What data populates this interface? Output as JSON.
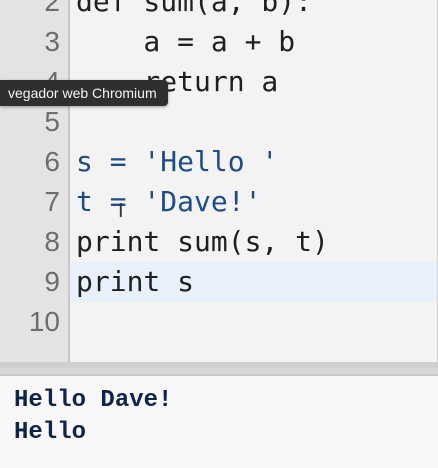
{
  "tooltip": {
    "text": "vegador web Chromium"
  },
  "editor": {
    "line_numbers": [
      "2",
      "3",
      "4",
      "5",
      "6",
      "7",
      "8",
      "9",
      "10"
    ],
    "lines": [
      {
        "number": "2",
        "code": "def sum(a, b):"
      },
      {
        "number": "3",
        "code": "    a = a + b"
      },
      {
        "number": "4",
        "code": "    return a"
      },
      {
        "number": "5",
        "code": ""
      },
      {
        "number": "6",
        "code": "s = 'Hello '"
      },
      {
        "number": "7",
        "code": "t = 'Dave!'"
      },
      {
        "number": "8",
        "code": "print sum(s, t)"
      },
      {
        "number": "9",
        "code": "print s"
      },
      {
        "number": "10",
        "code": ""
      }
    ]
  },
  "output": {
    "lines": [
      "Hello Dave!",
      "Hello"
    ]
  },
  "colors": {
    "editor_background": "#f3f3f3",
    "gutter_background": "#e3e3e3",
    "highlight_line": "#e8f1fb",
    "string_text": "#1f4c86",
    "output_text": "#10244b",
    "tooltip_background": "#2f2f2f"
  },
  "icons": {
    "text_cursor": "i-beam-cursor-icon"
  }
}
